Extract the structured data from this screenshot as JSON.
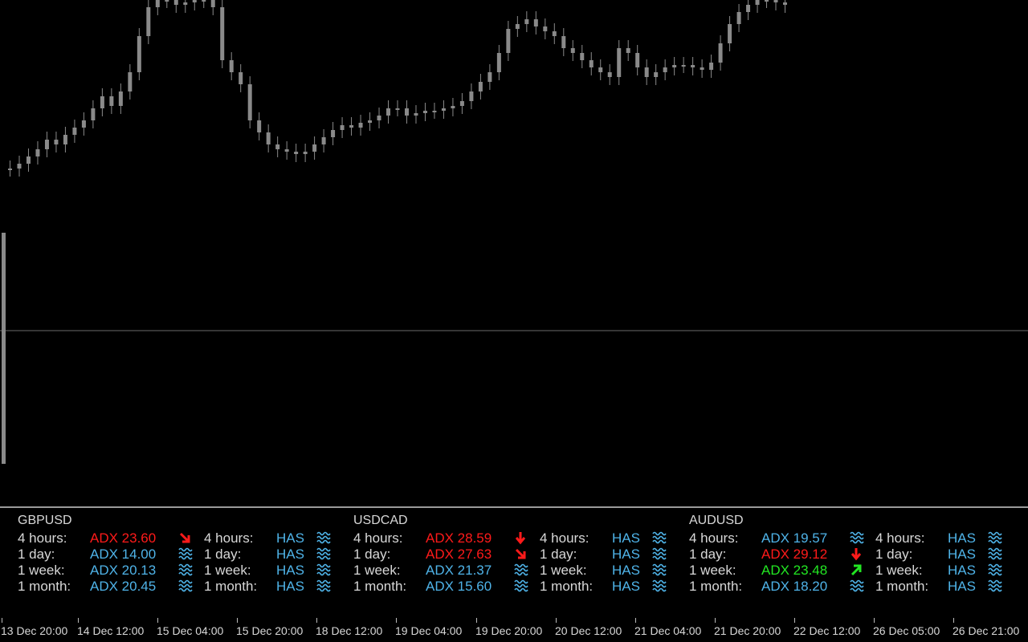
{
  "colors": {
    "background": "#000000",
    "candle": "#8a8a8a",
    "text": "#d8d8d8",
    "blue": "#4fb3e8",
    "red": "#ff1a1a",
    "green": "#22e622"
  },
  "panel": {
    "pairs": [
      {
        "symbol": "GBPUSD",
        "rows": [
          {
            "tf": "4 hours:",
            "adx": "ADX 23.60",
            "adx_color": "red",
            "trend_icon": "arrow-down-right-icon",
            "tf2": "4 hours:",
            "has": "HAS",
            "has_icon": "wave-icon"
          },
          {
            "tf": "1 day:",
            "adx": "ADX 14.00",
            "adx_color": "blue",
            "trend_icon": "wave-icon",
            "tf2": "1 day:",
            "has": "HAS",
            "has_icon": "wave-icon"
          },
          {
            "tf": "1 week:",
            "adx": "ADX 20.13",
            "adx_color": "blue",
            "trend_icon": "wave-icon",
            "tf2": "1 week:",
            "has": "HAS",
            "has_icon": "wave-icon"
          },
          {
            "tf": "1 month:",
            "adx": "ADX 20.45",
            "adx_color": "blue",
            "trend_icon": "wave-icon",
            "tf2": "1 month:",
            "has": "HAS",
            "has_icon": "wave-icon"
          }
        ]
      },
      {
        "symbol": "USDCAD",
        "rows": [
          {
            "tf": "4 hours:",
            "adx": "ADX 28.59",
            "adx_color": "red",
            "trend_icon": "arrow-down-icon",
            "tf2": "4 hours:",
            "has": "HAS",
            "has_icon": "wave-icon"
          },
          {
            "tf": "1 day:",
            "adx": "ADX 27.63",
            "adx_color": "red",
            "trend_icon": "arrow-down-right-icon",
            "tf2": "1 day:",
            "has": "HAS",
            "has_icon": "wave-icon"
          },
          {
            "tf": "1 week:",
            "adx": "ADX 21.37",
            "adx_color": "blue",
            "trend_icon": "wave-icon",
            "tf2": "1 week:",
            "has": "HAS",
            "has_icon": "wave-icon"
          },
          {
            "tf": "1 month:",
            "adx": "ADX 15.60",
            "adx_color": "blue",
            "trend_icon": "wave-icon",
            "tf2": "1 month:",
            "has": "HAS",
            "has_icon": "wave-icon"
          }
        ]
      },
      {
        "symbol": "AUDUSD",
        "rows": [
          {
            "tf": "4 hours:",
            "adx": "ADX 19.57",
            "adx_color": "blue",
            "trend_icon": "wave-icon",
            "tf2": "4 hours:",
            "has": "HAS",
            "has_icon": "wave-icon"
          },
          {
            "tf": "1 day:",
            "adx": "ADX 29.12",
            "adx_color": "red",
            "trend_icon": "arrow-down-icon",
            "tf2": "1 day:",
            "has": "HAS",
            "has_icon": "wave-icon"
          },
          {
            "tf": "1 week:",
            "adx": "ADX 23.48",
            "adx_color": "green",
            "trend_icon": "arrow-up-right-icon",
            "tf2": "1 week:",
            "has": "HAS",
            "has_icon": "wave-icon"
          },
          {
            "tf": "1 month:",
            "adx": "ADX 18.20",
            "adx_color": "blue",
            "trend_icon": "wave-icon",
            "tf2": "1 month:",
            "has": "HAS",
            "has_icon": "wave-icon"
          }
        ]
      }
    ]
  },
  "time_axis": {
    "labels": [
      "13 Dec 20:00",
      "14 Dec 12:00",
      "15 Dec 04:00",
      "15 Dec 20:00",
      "18 Dec 12:00",
      "19 Dec 04:00",
      "19 Dec 20:00",
      "20 Dec 12:00",
      "21 Dec 04:00",
      "21 Dec 20:00",
      "22 Dec 12:00",
      "26 Dec 05:00",
      "26 Dec 21:00"
    ]
  },
  "chart_data": {
    "type": "candlestick",
    "price_scale_visible": false,
    "grid": false,
    "horizontal_line": true,
    "close_series": [
      0.3,
      0.32,
      0.35,
      0.38,
      0.42,
      0.4,
      0.44,
      0.47,
      0.5,
      0.55,
      0.6,
      0.56,
      0.62,
      0.7,
      0.85,
      0.97,
      1.0,
      1.0,
      0.98,
      0.99,
      1.0,
      1.0,
      0.97,
      0.75,
      0.7,
      0.65,
      0.5,
      0.45,
      0.4,
      0.38,
      0.37,
      0.36,
      0.37,
      0.4,
      0.43,
      0.46,
      0.48,
      0.47,
      0.49,
      0.5,
      0.52,
      0.55,
      0.55,
      0.52,
      0.53,
      0.54,
      0.54,
      0.55,
      0.56,
      0.58,
      0.62,
      0.66,
      0.7,
      0.78,
      0.88,
      0.9,
      0.92,
      0.89,
      0.87,
      0.85,
      0.8,
      0.78,
      0.75,
      0.72,
      0.7,
      0.68,
      0.8,
      0.78,
      0.72,
      0.68,
      0.7,
      0.72,
      0.73,
      0.73,
      0.72,
      0.71,
      0.74,
      0.82,
      0.9,
      0.95,
      0.98,
      1.0,
      1.0,
      0.99,
      0.98
    ]
  }
}
